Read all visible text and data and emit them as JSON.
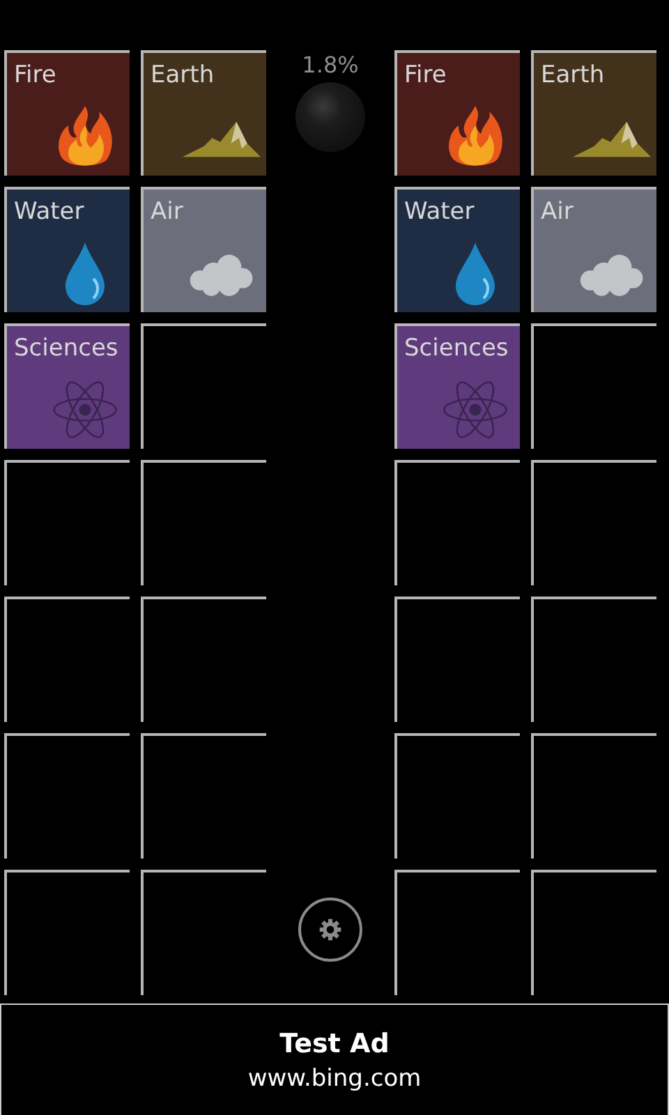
{
  "boards": [
    {
      "tiles": [
        {
          "kind": "fire",
          "label": "Fire",
          "color": "#4a1c1a"
        },
        {
          "kind": "earth",
          "label": "Earth",
          "color": "#43321b"
        },
        {
          "kind": "water",
          "label": "Water",
          "color": "#1f2d44"
        },
        {
          "kind": "air",
          "label": "Air",
          "color": "#6c6e7b"
        },
        {
          "kind": "science",
          "label": "Sciences",
          "color": "#5f3a7c"
        },
        {
          "kind": "empty"
        },
        {
          "kind": "empty"
        },
        {
          "kind": "empty"
        },
        {
          "kind": "empty"
        },
        {
          "kind": "empty"
        },
        {
          "kind": "empty"
        },
        {
          "kind": "empty"
        },
        {
          "kind": "empty"
        },
        {
          "kind": "empty"
        }
      ]
    },
    {
      "tiles": [
        {
          "kind": "fire",
          "label": "Fire",
          "color": "#4a1c1a"
        },
        {
          "kind": "earth",
          "label": "Earth",
          "color": "#43321b"
        },
        {
          "kind": "water",
          "label": "Water",
          "color": "#1f2d44"
        },
        {
          "kind": "air",
          "label": "Air",
          "color": "#6c6e7b"
        },
        {
          "kind": "science",
          "label": "Sciences",
          "color": "#5f3a7c"
        },
        {
          "kind": "empty"
        },
        {
          "kind": "empty"
        },
        {
          "kind": "empty"
        },
        {
          "kind": "empty"
        },
        {
          "kind": "empty"
        },
        {
          "kind": "empty"
        },
        {
          "kind": "empty"
        },
        {
          "kind": "empty"
        },
        {
          "kind": "empty"
        }
      ]
    }
  ],
  "progress": "1.8%",
  "ad": {
    "title": "Test Ad",
    "url": "www.bing.com"
  }
}
